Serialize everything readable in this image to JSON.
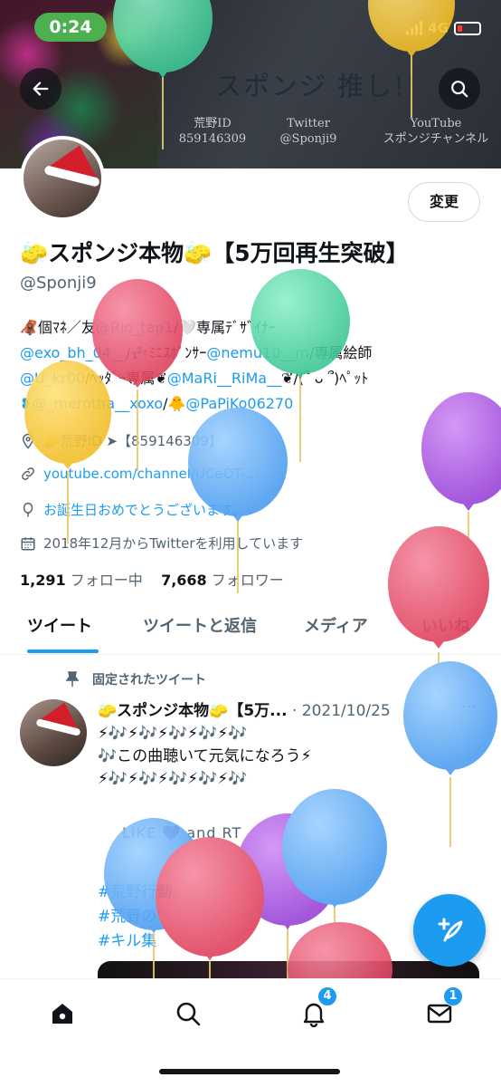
{
  "status_bar": {
    "time": "0:24",
    "network": "4G"
  },
  "banner": {
    "title": "スポンジ 推し!!",
    "columns": [
      {
        "line1": "荒野ID",
        "line2": "859146309"
      },
      {
        "line1": "Twitter",
        "line2": "@Sponji9"
      },
      {
        "line1": "YouTube",
        "line2": "スポンジチャンネル"
      }
    ]
  },
  "profile": {
    "edit_button": "変更",
    "display_name": "🧽スポンジ本物🧽【5万回再生突破】",
    "handle": "@Sponji9",
    "bio": {
      "line1_a": "🦧個ﾏﾈ／友",
      "line1_link": "@Rio_tap1",
      "line1_b": "/🤍専属ﾃﾞｻﾞｲﾅｰ",
      "line2_link1": "@exo_bh_04__",
      "line2_a": "/💤ﾐﾆｽﾎﾟﾝｻｰ",
      "line2_link2": "@nemu10__m",
      "line2_b": "/専属絵師",
      "line3_link1": "@U_kr00",
      "line3_a": "/ﾍｯﾀﾞｰ専属❦",
      "line3_link2": "@MaRi__RiMa__",
      "line3_b": "❦/(՞ ᴗ ՞)ﾍﾟｯﾄ",
      "line4_link1": "❥@_merotha__xoxo",
      "line4_a": "/🐥",
      "line4_link2": "@PaPiKo06270"
    },
    "location": "🧽荒野ID ➤【859146309】",
    "website": "youtube.com/channel/UCeOT-...",
    "birthday": "お誕生日おめでとうございます。",
    "joined": "2018年12月からTwitterを利用しています",
    "following_count": "1,291",
    "following_label": "フォロー中",
    "followers_count": "7,668",
    "followers_label": "フォロワー"
  },
  "tabs": [
    "ツイート",
    "ツイートと返信",
    "メディア",
    "いいね"
  ],
  "tweet": {
    "pinned_label": "固定されたツイート",
    "author": "🧽スポンジ本物🧽【5万...",
    "date": "· 2021/10/25",
    "more": "···",
    "line1": "⚡🎶⚡🎶⚡🎶⚡🎶⚡🎶",
    "line2": "🎶この曲聴いて元気になろう⚡",
    "line3": "⚡🎶⚡🎶⚡🎶⚡🎶⚡🎶",
    "like_text": "LIKE 💜 and RT",
    "hashtags": [
      "#荒野行動",
      "#荒野の",
      "#キル集"
    ]
  },
  "nav": {
    "notifications_badge": "4",
    "messages_badge": "1"
  },
  "colors": {
    "accent": "#1d9bf0",
    "text": "#0f1419",
    "muted": "#536471"
  }
}
